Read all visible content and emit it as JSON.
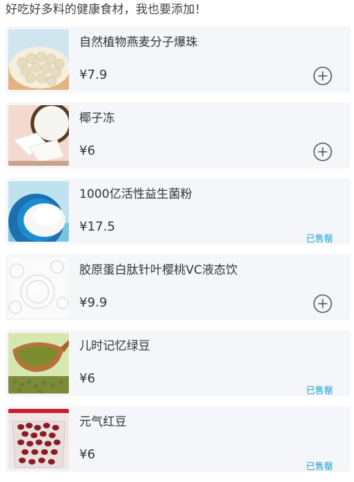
{
  "header": {
    "title": "好吃好多料的健康食材，我也要添加！"
  },
  "colors": {
    "card_bg": "#f5f6f9",
    "sold_out": "#1fa3d6",
    "add_icon": "#555555"
  },
  "products": [
    {
      "name": "自然植物燕麦分子爆珠",
      "price": "¥7.9",
      "status": "available",
      "image": "tapioca-pearls-image"
    },
    {
      "name": "椰子冻",
      "price": "¥6",
      "status": "available",
      "image": "coconut-jelly-image"
    },
    {
      "name": "1000亿活性益生菌粉",
      "price": "¥17.5",
      "status": "sold_out",
      "status_label": "已售罄",
      "image": "probiotic-powder-image"
    },
    {
      "name": "胶原蛋白肽针叶樱桃VC液态饮",
      "price": "¥9.9",
      "status": "available",
      "image": "collagen-drink-image"
    },
    {
      "name": "儿时记忆绿豆",
      "price": "¥6",
      "status": "sold_out",
      "status_label": "已售罄",
      "image": "mung-beans-image"
    },
    {
      "name": "元气红豆",
      "price": "¥6",
      "status": "sold_out",
      "status_label": "已售罄",
      "image": "red-beans-image"
    }
  ]
}
